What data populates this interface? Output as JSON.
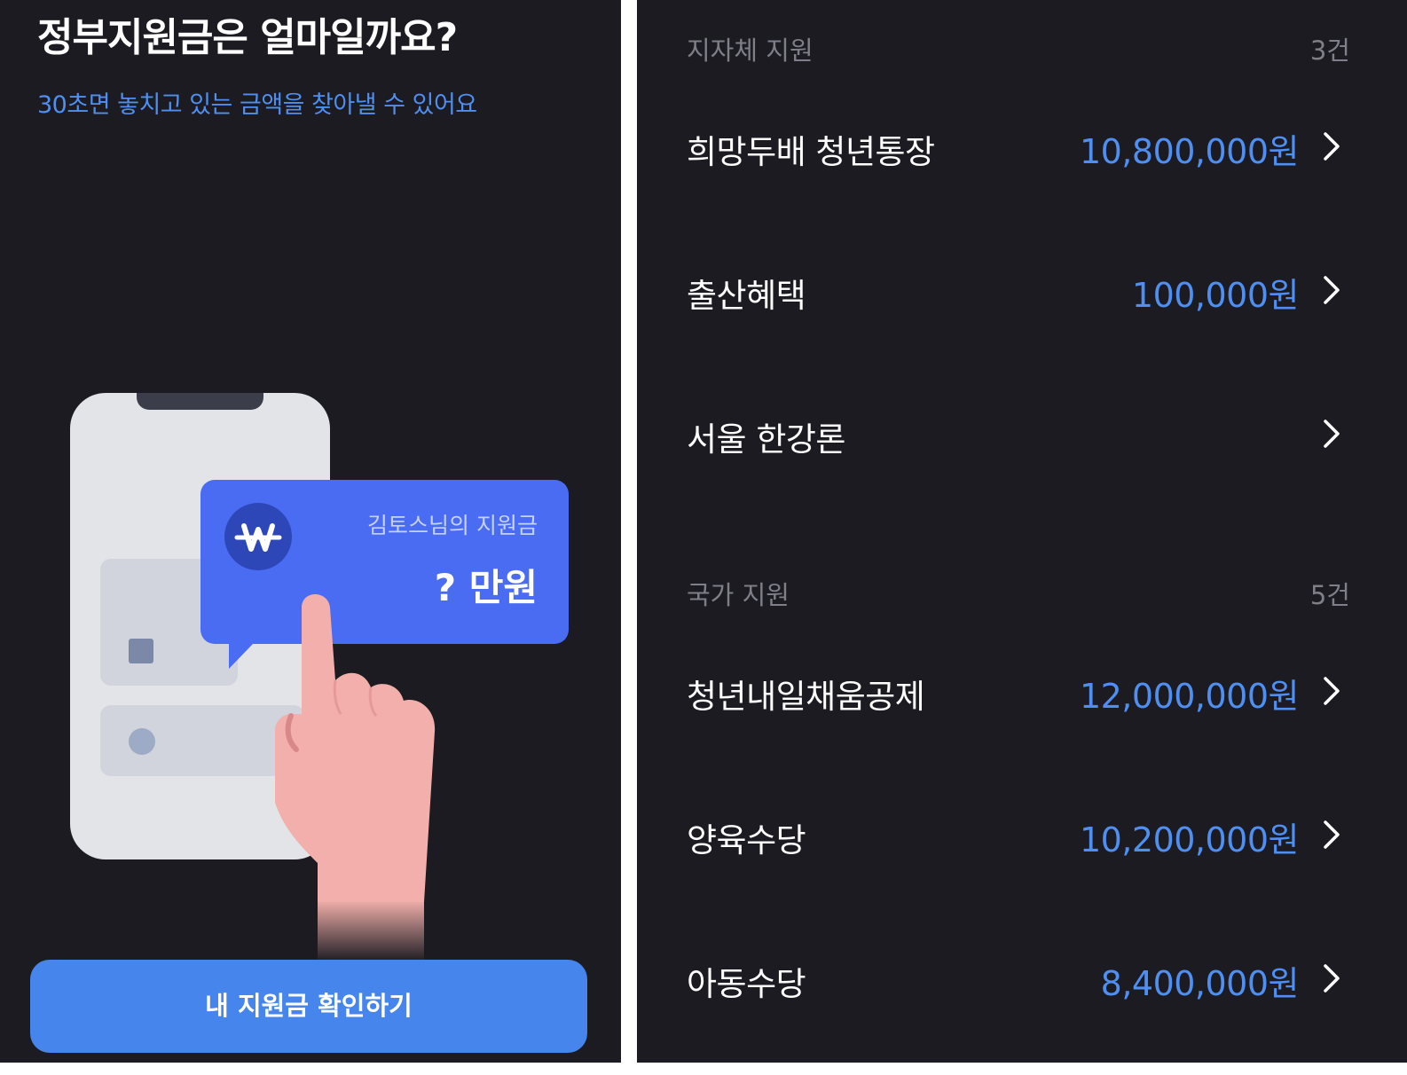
{
  "left": {
    "title": "정부지원금은 얼마일까요?",
    "subtitle": "30초면 놓치고 있는 금액을 찾아낼 수 있어요",
    "illustration": {
      "bubble_label": "김토스님의 지원금",
      "bubble_amount": "? 만원",
      "badge_icon": "won-sign-icon"
    },
    "cta_label": "내 지원금 확인하기"
  },
  "right": {
    "sections": [
      {
        "title": "지자체 지원",
        "count": "3건",
        "items": [
          {
            "name": "희망두배 청년통장",
            "amount": "10,800,000원"
          },
          {
            "name": "출산혜택",
            "amount": "100,000원"
          },
          {
            "name": "서울 한강론",
            "amount": ""
          }
        ]
      },
      {
        "title": "국가 지원",
        "count": "5건",
        "items": [
          {
            "name": "청년내일채움공제",
            "amount": "12,000,000원"
          },
          {
            "name": "양육수당",
            "amount": "10,200,000원"
          },
          {
            "name": "아동수당",
            "amount": "8,400,000원"
          }
        ]
      }
    ]
  },
  "colors": {
    "background": "#1b1b21",
    "accent_blue": "#4f8ff1",
    "button_blue": "#4685ec",
    "bubble_blue": "#4a6cf3",
    "muted_text": "#7e7f88"
  }
}
